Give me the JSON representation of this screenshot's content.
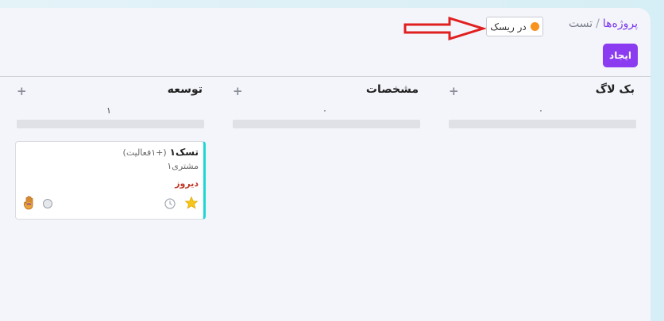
{
  "breadcrumb": {
    "projects": "پروژه‌ها",
    "separator": "/",
    "current": "تست"
  },
  "status": {
    "label": "در ریسک",
    "color": "#f7931e"
  },
  "toolbar": {
    "create_label": "ایجاد"
  },
  "columns": [
    {
      "title": "بک لاگ",
      "count": "۰"
    },
    {
      "title": "مشخصات",
      "count": "۰"
    },
    {
      "title": "توسعه",
      "count": "۱"
    }
  ],
  "card": {
    "title": "تسک۱",
    "activity": "(+۱فعالیت)",
    "customer": "مشتری۱",
    "due": "دیروز",
    "accent": "#1ed6d6"
  },
  "icons": {
    "add": "plus-icon",
    "star": "star-icon",
    "clock": "clock-icon",
    "hand": "hand-icon"
  }
}
